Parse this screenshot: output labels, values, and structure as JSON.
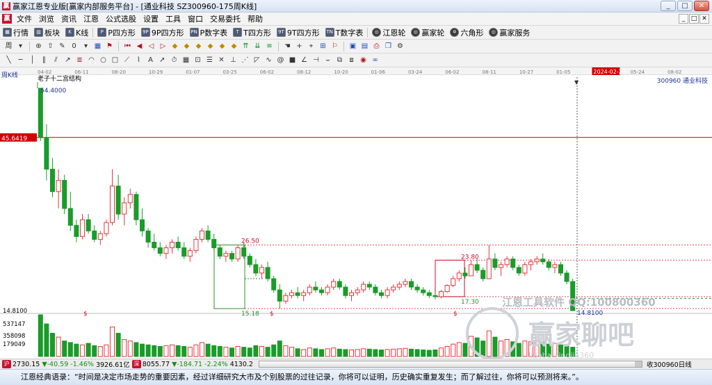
{
  "window": {
    "title": "赢家江恩专业版[赢家内部服务平台] - [通业科技  SZ300960-175周K线]",
    "buttons": [
      "_",
      "□",
      "✕"
    ]
  },
  "menu": {
    "items": [
      "文件",
      "浏览",
      "资讯",
      "江恩",
      "公式选股",
      "设置",
      "工具",
      "窗口",
      "交易委托",
      "帮助"
    ]
  },
  "toolbar1": {
    "items": [
      {
        "label": "行情",
        "icon": "grid-icon"
      },
      {
        "label": "板块",
        "icon": "blocks-icon"
      },
      {
        "label": "K线",
        "icon": "candle-icon"
      },
      {
        "label": "P四方形",
        "icon": "p-square-icon"
      },
      {
        "label": "9P四方形",
        "icon": "9p-square-icon"
      },
      {
        "label": "P数字表",
        "icon": "p-table-icon"
      },
      {
        "label": "T四方形",
        "icon": "t-square-icon"
      },
      {
        "label": "9T四方形",
        "icon": "9t-square-icon"
      },
      {
        "label": "T数字表",
        "icon": "t-table-icon"
      },
      {
        "label": "江恩轮",
        "icon": "gann-wheel-icon"
      },
      {
        "label": "赢家轮",
        "icon": "winner-wheel-icon"
      },
      {
        "label": "六角形",
        "icon": "hexagon-icon"
      },
      {
        "label": "赢家服务",
        "icon": "service-icon"
      }
    ]
  },
  "toolbar2": {
    "period": "周",
    "count": "0"
  },
  "chart": {
    "period_label": "周K线",
    "stock_code": "300960   通业科技",
    "structure_label": "老子十二宫结构",
    "date_ticks": [
      "04-02",
      "06-11",
      "08-20",
      "10-29",
      "01-07",
      "03-25",
      "06-02",
      "08-12",
      "10-20",
      "01-06",
      "03-24",
      "06-02",
      "08-11",
      "10-27",
      "01-05",
      "2024-02-23",
      "05-24",
      "08-02"
    ],
    "current_date": "2024-02-23",
    "price_marker": "45.6419",
    "labels": {
      "high": "54.4000",
      "box_top": "26.50",
      "box_low": "15.18",
      "box2_top": "23.80",
      "box2_low": "17.30",
      "latest": "14.8100",
      "watermark1": "江恩工具软件 QQ:100800360",
      "watermark2": "赢家聊吧",
      "watermark3": "liaoba.yingjia360",
      "dollar": "$"
    },
    "volume_axis": [
      "14.8100",
      "537147",
      "358098",
      "179049"
    ],
    "colors": {
      "up": "#e8353c",
      "down": "#1a9b2a",
      "box": "#2e8c2e",
      "box2": "#c8102e",
      "dash": "#e8353c",
      "marker": "#d20000"
    }
  },
  "chart_data": {
    "type": "candlestick",
    "title": "通业科技 SZ300960 周K线",
    "candles": [
      [
        54.4,
        54.4,
        45.0,
        45.6
      ],
      [
        45.6,
        48.0,
        38.0,
        40.0
      ],
      [
        40.0,
        42.0,
        35.0,
        36.0
      ],
      [
        36.0,
        40.0,
        33.0,
        38.0
      ],
      [
        38.0,
        39.0,
        32.0,
        33.0
      ],
      [
        33.0,
        36.0,
        29.0,
        30.0
      ],
      [
        30.0,
        31.0,
        27.0,
        28.0
      ],
      [
        28.0,
        32.0,
        27.5,
        31.0
      ],
      [
        31.0,
        32.0,
        28.5,
        29.0
      ],
      [
        29.0,
        30.0,
        27.0,
        27.5
      ],
      [
        27.5,
        29.0,
        26.5,
        28.5
      ],
      [
        28.5,
        31.0,
        28.0,
        30.5
      ],
      [
        30.5,
        40.0,
        30.0,
        37.0
      ],
      [
        37.0,
        39.0,
        31.0,
        32.0
      ],
      [
        32.0,
        35.0,
        30.0,
        34.0
      ],
      [
        34.0,
        36.5,
        33.0,
        35.5
      ],
      [
        35.5,
        36.0,
        30.0,
        31.0
      ],
      [
        31.0,
        33.0,
        28.0,
        29.0
      ],
      [
        29.0,
        29.5,
        26.0,
        27.0
      ],
      [
        27.0,
        28.5,
        25.5,
        26.0
      ],
      [
        26.0,
        27.0,
        24.5,
        25.0
      ],
      [
        25.0,
        26.5,
        24.0,
        26.0
      ],
      [
        26.0,
        27.5,
        25.0,
        27.0
      ],
      [
        27.0,
        28.0,
        25.5,
        26.0
      ],
      [
        26.0,
        27.0,
        24.0,
        24.5
      ],
      [
        24.5,
        26.0,
        23.5,
        25.5
      ],
      [
        25.5,
        28.0,
        25.0,
        27.5
      ],
      [
        27.5,
        29.5,
        27.0,
        29.0
      ],
      [
        29.0,
        30.0,
        27.0,
        27.5
      ],
      [
        27.5,
        28.5,
        25.5,
        26.0
      ],
      [
        26.0,
        26.5,
        24.0,
        24.5
      ],
      [
        24.5,
        25.5,
        23.5,
        25.0
      ],
      [
        25.0,
        25.5,
        23.5,
        24.0
      ],
      [
        24.0,
        26.5,
        23.5,
        26.0
      ],
      [
        26.0,
        27.0,
        24.0,
        24.5
      ],
      [
        24.5,
        25.0,
        22.5,
        23.0
      ],
      [
        23.0,
        24.0,
        21.0,
        21.5
      ],
      [
        21.5,
        23.0,
        20.5,
        22.5
      ],
      [
        22.5,
        23.5,
        20.0,
        20.5
      ],
      [
        20.5,
        21.0,
        18.0,
        18.5
      ],
      [
        18.5,
        19.5,
        15.18,
        16.5
      ],
      [
        16.5,
        18.0,
        16.0,
        17.5
      ],
      [
        17.5,
        18.5,
        17.0,
        18.0
      ],
      [
        18.0,
        19.0,
        17.0,
        17.5
      ],
      [
        17.5,
        18.5,
        16.5,
        18.0
      ],
      [
        18.0,
        19.5,
        17.5,
        19.0
      ],
      [
        19.0,
        20.0,
        18.0,
        18.5
      ],
      [
        18.5,
        19.0,
        17.5,
        18.0
      ],
      [
        18.0,
        19.5,
        17.5,
        19.0
      ],
      [
        19.0,
        20.5,
        18.5,
        20.0
      ],
      [
        20.0,
        20.5,
        18.5,
        19.0
      ],
      [
        19.0,
        19.5,
        17.0,
        17.5
      ],
      [
        17.5,
        18.5,
        16.5,
        18.0
      ],
      [
        18.0,
        19.0,
        17.5,
        18.5
      ],
      [
        18.5,
        20.0,
        18.0,
        19.5
      ],
      [
        19.5,
        20.0,
        18.5,
        19.0
      ],
      [
        19.0,
        19.5,
        17.5,
        18.0
      ],
      [
        18.0,
        18.5,
        17.0,
        17.5
      ],
      [
        17.5,
        19.0,
        17.0,
        18.5
      ],
      [
        18.5,
        19.5,
        18.0,
        19.0
      ],
      [
        19.0,
        20.0,
        18.5,
        19.5
      ],
      [
        19.5,
        20.5,
        19.0,
        20.0
      ],
      [
        20.0,
        20.5,
        18.5,
        19.0
      ],
      [
        19.0,
        19.5,
        18.0,
        18.5
      ],
      [
        18.5,
        19.0,
        17.5,
        18.0
      ],
      [
        18.0,
        18.5,
        17.0,
        17.5
      ],
      [
        17.5,
        18.0,
        16.8,
        17.3
      ],
      [
        17.3,
        18.5,
        17.0,
        18.2
      ],
      [
        18.2,
        19.5,
        18.0,
        19.3
      ],
      [
        19.3,
        21.0,
        19.0,
        20.5
      ],
      [
        20.5,
        22.0,
        20.0,
        21.5
      ],
      [
        21.5,
        22.5,
        20.5,
        21.0
      ],
      [
        21.0,
        23.8,
        21.0,
        23.0
      ],
      [
        23.0,
        24.0,
        21.5,
        22.0
      ],
      [
        22.0,
        22.5,
        20.0,
        20.5
      ],
      [
        20.5,
        26.5,
        20.5,
        24.0
      ],
      [
        24.0,
        25.0,
        22.0,
        22.5
      ],
      [
        22.5,
        23.5,
        21.0,
        23.0
      ],
      [
        23.0,
        24.5,
        22.5,
        24.0
      ],
      [
        24.0,
        24.5,
        22.0,
        22.5
      ],
      [
        22.5,
        23.0,
        21.0,
        21.5
      ],
      [
        21.5,
        23.5,
        21.0,
        23.0
      ],
      [
        23.0,
        24.0,
        22.0,
        23.5
      ],
      [
        23.5,
        24.5,
        23.0,
        24.0
      ],
      [
        24.0,
        25.0,
        23.0,
        23.5
      ],
      [
        23.5,
        24.0,
        22.0,
        22.5
      ],
      [
        22.5,
        23.5,
        21.5,
        23.0
      ],
      [
        23.0,
        23.5,
        21.0,
        21.5
      ],
      [
        21.5,
        22.0,
        19.5,
        20.0
      ],
      [
        20.0,
        20.5,
        14.81,
        14.81
      ]
    ],
    "volumes": [
      537147,
      420000,
      300000,
      250000,
      200000,
      180000,
      160000,
      150000,
      170000,
      140000,
      130000,
      150000,
      380000,
      300000,
      220000,
      200000,
      180000,
      160000,
      150000,
      140000,
      130000,
      140000,
      150000,
      140000,
      130000,
      120000,
      150000,
      180000,
      160000,
      140000,
      130000,
      120000,
      110000,
      130000,
      120000,
      110000,
      140000,
      130000,
      120000,
      150000,
      200000,
      140000,
      120000,
      100000,
      90000,
      110000,
      100000,
      90000,
      100000,
      110000,
      95000,
      90000,
      85000,
      90000,
      100000,
      95000,
      90000,
      85000,
      90000,
      95000,
      100000,
      105000,
      95000,
      90000,
      85000,
      80000,
      85000,
      110000,
      130000,
      160000,
      180000,
      170000,
      260000,
      240000,
      200000,
      330000,
      250000,
      200000,
      220000,
      190000,
      170000,
      200000,
      190000,
      200000,
      180000,
      160000,
      170000,
      150000,
      140000,
      120000
    ],
    "ylim": [
      14.81,
      54.4
    ],
    "price_levels": [
      26.5,
      23.8,
      17.3,
      15.18
    ]
  },
  "status": {
    "index1_value": "2730.15",
    "index1_change": "▼-40.59",
    "index1_pct": "-1.46%",
    "index1_amount": "3926.61亿",
    "index2_value": "8055.77",
    "index2_change": "▼-184.71",
    "index2_pct": "-2.24%",
    "index2_amount": "4130.2",
    "message": "收300960日线"
  },
  "footer": {
    "quote": "江恩经典语录：“时间是决定市场走势的重要因素，经过详细研究大市及个别股票的过往记录，你将可以证明，历史确实重复发生；而了解过往，你将可以预测将来。”。"
  }
}
